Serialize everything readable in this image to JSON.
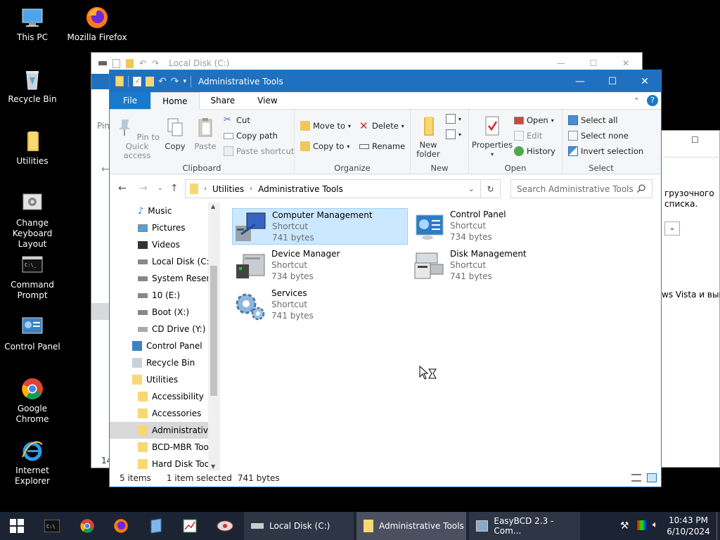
{
  "desktop": {
    "icons": [
      {
        "label": "This PC"
      },
      {
        "label": "Mozilla Firefox"
      },
      {
        "label": "Recycle Bin"
      },
      {
        "label": "Utilities"
      },
      {
        "label": "Change Keyboard Layout"
      },
      {
        "label": "Command Prompt"
      },
      {
        "label": "Control Panel"
      },
      {
        "label": "Google Chrome"
      },
      {
        "label": "Internet Explorer"
      }
    ]
  },
  "bg_window": {
    "title": "Local Disk (C:)",
    "pin_text": "Pin",
    "status_text": "14"
  },
  "bg_window2": {
    "text1": "грузочного",
    "text2": "списка.",
    "text3": "ws Vista и выш"
  },
  "window": {
    "title": "Administrative Tools",
    "tabs": {
      "file": "File",
      "home": "Home",
      "share": "Share",
      "view": "View"
    },
    "ribbon": {
      "clipboard": {
        "label": "Clipboard",
        "pin": "Pin to Quick access",
        "copy": "Copy",
        "paste": "Paste",
        "cut": "Cut",
        "copy_path": "Copy path",
        "paste_shortcut": "Paste shortcut"
      },
      "organize": {
        "label": "Organize",
        "move_to": "Move to",
        "copy_to": "Copy to",
        "delete": "Delete",
        "rename": "Rename"
      },
      "new": {
        "label": "New",
        "new_folder": "New folder"
      },
      "open": {
        "label": "Open",
        "properties": "Properties",
        "open": "Open",
        "edit": "Edit",
        "history": "History"
      },
      "select": {
        "label": "Select",
        "select_all": "Select all",
        "select_none": "Select none",
        "invert": "Invert selection"
      }
    },
    "address": {
      "crumb1": "Utilities",
      "crumb2": "Administrative Tools"
    },
    "search_placeholder": "Search Administrative Tools",
    "nav": [
      "Music",
      "Pictures",
      "Videos",
      "Local Disk (C:)",
      "System Reserve",
      "10 (E:)",
      "Boot (X:)",
      "CD Drive (Y:) H",
      "Control Panel",
      "Recycle Bin",
      "Utilities",
      "Accessibility",
      "Accessories",
      "Administrative",
      "BCD-MBR Tool",
      "Hard Disk Tool"
    ],
    "files": [
      {
        "name": "Computer Management",
        "type": "Shortcut",
        "size": "741 bytes"
      },
      {
        "name": "Control Panel",
        "type": "Shortcut",
        "size": "734 bytes"
      },
      {
        "name": "Device Manager",
        "type": "Shortcut",
        "size": "734 bytes"
      },
      {
        "name": "Disk Management",
        "type": "Shortcut",
        "size": "741 bytes"
      },
      {
        "name": "Services",
        "type": "Shortcut",
        "size": "741 bytes"
      }
    ],
    "status": {
      "count": "5 items",
      "selected": "1 item selected",
      "size": "741 bytes"
    }
  },
  "taskbar": {
    "tasks": [
      {
        "label": "Local Disk (C:)"
      },
      {
        "label": "Administrative Tools"
      },
      {
        "label": "EasyBCD 2.3 - Com..."
      }
    ],
    "time": "10:43 PM",
    "date": "6/10/2024"
  },
  "colors": {
    "titlebar": "#1f71c0",
    "file_tab": "#1979ca",
    "selection": "#cce8ff",
    "taskbar": "#1c2434"
  }
}
